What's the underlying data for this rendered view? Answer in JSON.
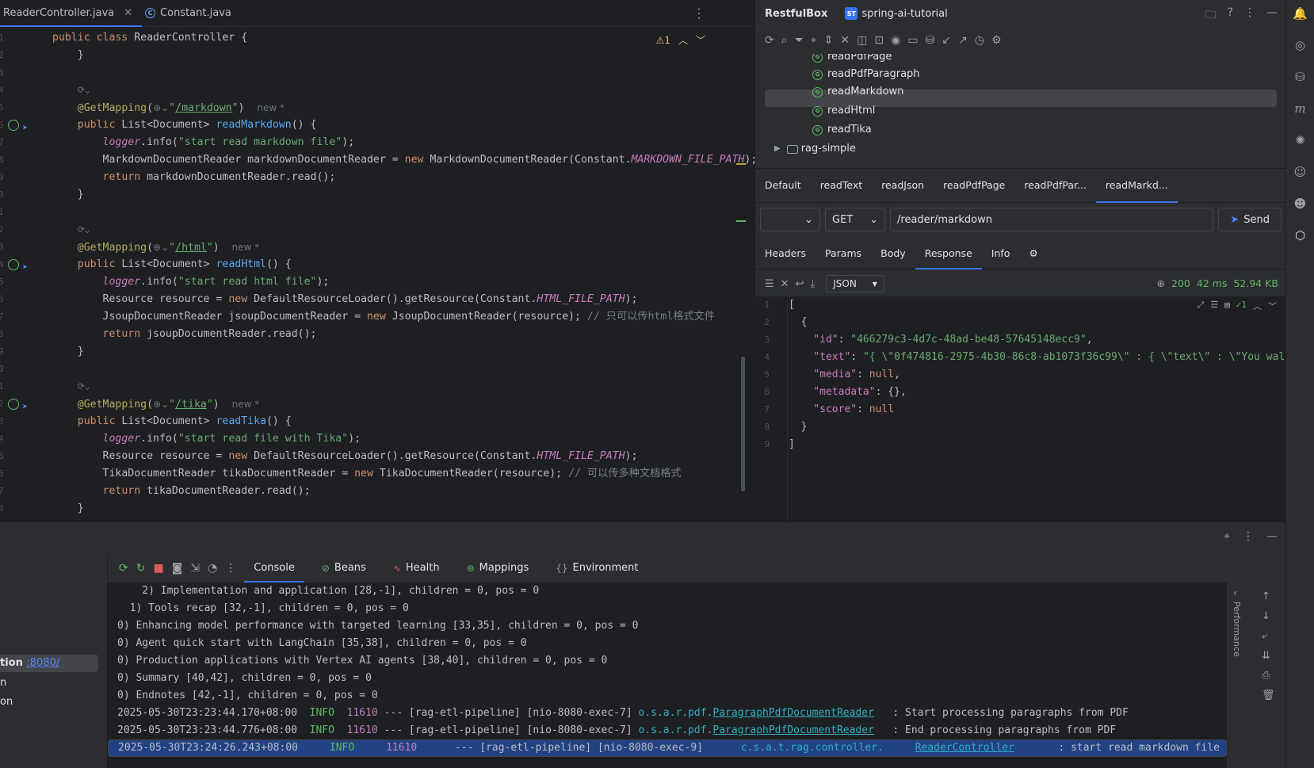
{
  "editor": {
    "tabs": [
      {
        "label": "ReaderController.java",
        "active": true
      },
      {
        "label": "Constant.java",
        "active": false
      }
    ],
    "warning_count": "1",
    "lines": [
      {
        "n": "1",
        "html": "<span class=\"kw\">public class</span> ReaderController {",
        "indent": 0
      },
      {
        "n": "2",
        "html": "    }",
        "indent": 0
      },
      {
        "n": "3",
        "html": "",
        "indent": 0
      },
      {
        "n": "4",
        "html": "    <span class=\"fold\">⟳⌄</span>",
        "indent": 0
      },
      {
        "n": "5",
        "html": "    <span class=\"ann\">@GetMapping</span>(<span class=\"hint\">⊕⌄</span><span class=\"str\">\"<u>/markdown</u>\"</span>)  <span class=\"hint\">new *</span>",
        "indent": 0
      },
      {
        "n": "6",
        "html": "    <span class=\"kw\">public</span> List&lt;Document&gt; <span class=\"fn\">readMarkdown</span>() {",
        "indent": 0
      },
      {
        "n": "7",
        "html": "        <span class=\"cst\">logger</span>.info(<span class=\"str\">\"start read markdown file\"</span>);",
        "indent": 0
      },
      {
        "n": "8",
        "html": "        MarkdownDocumentReader markdownDocumentReader = <span class=\"kw\">new</span> MarkdownDocumentReader(Constant.<span class=\"cst\">MARKDOWN_FILE_PATH</span>);",
        "indent": 0
      },
      {
        "n": "9",
        "html": "        <span class=\"kw\">return</span> markdownDocumentReader.read();",
        "indent": 0
      },
      {
        "n": "0",
        "html": "    }",
        "indent": 0
      },
      {
        "n": "1",
        "html": "",
        "indent": 0
      },
      {
        "n": "2",
        "html": "    <span class=\"fold\">⟳⌄</span>",
        "indent": 0
      },
      {
        "n": "3",
        "html": "    <span class=\"ann\">@GetMapping</span>(<span class=\"hint\">⊕⌄</span><span class=\"str\">\"<u>/html</u>\"</span>)  <span class=\"hint\">new *</span>",
        "indent": 0
      },
      {
        "n": "4",
        "html": "    <span class=\"kw\">public</span> List&lt;Document&gt; <span class=\"fn\">readHtml</span>() {",
        "indent": 0
      },
      {
        "n": "5",
        "html": "        <span class=\"cst\">logger</span>.info(<span class=\"str\">\"start read html file\"</span>);",
        "indent": 0
      },
      {
        "n": "6",
        "html": "        Resource resource = <span class=\"kw\">new</span> DefaultResourceLoader().getResource(Constant.<span class=\"cst\">HTML_FILE_PATH</span>);",
        "indent": 0
      },
      {
        "n": "7",
        "html": "        JsoupDocumentReader jsoupDocumentReader = <span class=\"kw\">new</span> JsoupDocumentReader(resource); <span class=\"cmt\">// 只可以传html格式文件</span>",
        "indent": 0
      },
      {
        "n": "8",
        "html": "        <span class=\"kw\">return</span> jsoupDocumentReader.read();",
        "indent": 0
      },
      {
        "n": "9",
        "html": "    }",
        "indent": 0
      },
      {
        "n": "0",
        "html": "",
        "indent": 0
      },
      {
        "n": "1",
        "html": "    <span class=\"fold\">⟳⌄</span>",
        "indent": 0
      },
      {
        "n": "2",
        "html": "    <span class=\"ann\">@GetMapping</span>(<span class=\"hint\">⊕⌄</span><span class=\"str\">\"<u>/tika</u>\"</span>)  <span class=\"hint\">new *</span>",
        "indent": 0
      },
      {
        "n": "3",
        "html": "    <span class=\"kw\">public</span> List&lt;Document&gt; <span class=\"fn\">readTika</span>() {",
        "indent": 0
      },
      {
        "n": "4",
        "html": "        <span class=\"cst\">logger</span>.info(<span class=\"str\">\"start read file with Tika\"</span>);",
        "indent": 0
      },
      {
        "n": "5",
        "html": "        Resource resource = <span class=\"kw\">new</span> DefaultResourceLoader().getResource(Constant.<span class=\"cst\">HTML_FILE_PATH</span>);",
        "indent": 0
      },
      {
        "n": "6",
        "html": "        TikaDocumentReader tikaDocumentReader = <span class=\"kw\">new</span> TikaDocumentReader(resource); <span class=\"cmt\">// 可以传多种文档格式</span>",
        "indent": 0
      },
      {
        "n": "7",
        "html": "        <span class=\"kw\">return</span> tikaDocumentReader.read();",
        "indent": 0
      },
      {
        "n": "8",
        "html": "    }",
        "indent": 0
      },
      {
        "n": "9",
        "html": "}",
        "indent": 0
      }
    ]
  },
  "restful": {
    "title": "RestfulBox",
    "project_badge": "ST",
    "project": "spring-ai-tutorial",
    "tree": [
      {
        "label": "readPdfPage",
        "type": "endpoint"
      },
      {
        "label": "readPdfParagraph",
        "type": "endpoint"
      },
      {
        "label": "readMarkdown",
        "type": "endpoint",
        "selected": true
      },
      {
        "label": "readHtml",
        "type": "endpoint"
      },
      {
        "label": "readTika",
        "type": "endpoint"
      },
      {
        "label": "rag-simple",
        "type": "folder"
      }
    ],
    "request_tabs": [
      "Default",
      "readText",
      "readJson",
      "readPdfPage",
      "readPdfPar...",
      "readMarkd..."
    ],
    "env_value": "",
    "method": "GET",
    "url": "/reader/markdown",
    "send_label": "Send",
    "response_tabs": [
      "Headers",
      "Params",
      "Body",
      "Response",
      "Info"
    ],
    "format": "JSON",
    "status": "200",
    "time": "42 ms",
    "size": "52.94 KB",
    "check_count": "1",
    "json_lines": [
      {
        "n": "1",
        "html": "["
      },
      {
        "n": "2",
        "html": "  {"
      },
      {
        "n": "3",
        "html": "    <span class=\"jkey\">\"id\"</span>: <span class=\"jstr\">\"466279c3-4d7c-48ad-be48-57645148ecc9\"</span>,"
      },
      {
        "n": "4",
        "html": "    <span class=\"jkey\">\"text\"</span>: <span class=\"jstr\">\"{ \\\"0f474816-2975-4b30-86c8-ab1073f36c99\\\" : { \\\"text\\\" : \\\"You wal</span>"
      },
      {
        "n": "5",
        "html": "    <span class=\"jkey\">\"media\"</span>: <span class=\"jnull\">null</span>,"
      },
      {
        "n": "6",
        "html": "    <span class=\"jkey\">\"metadata\"</span>: {},"
      },
      {
        "n": "7",
        "html": "    <span class=\"jkey\">\"score\"</span>: <span class=\"jnull\">null</span>"
      },
      {
        "n": "8",
        "html": "  }"
      },
      {
        "n": "9",
        "html": "]"
      }
    ]
  },
  "services": {
    "selected_prefix": "tion ",
    "selected_link": ":8080/",
    "items": [
      "n",
      "on"
    ]
  },
  "console": {
    "tabs": [
      {
        "label": "Console",
        "icon": "",
        "active": true
      },
      {
        "label": "Beans",
        "icon": "beans-icon"
      },
      {
        "label": "Health",
        "icon": "health-icon"
      },
      {
        "label": "Mappings",
        "icon": "mappings-icon"
      },
      {
        "label": "Environment",
        "icon": "environment-icon"
      }
    ],
    "plain_lines": [
      "    2) Implementation and application [28,-1], children = 0, pos = 0",
      "  1) Tools recap [32,-1], children = 0, pos = 0",
      "0) Enhancing model performance with targeted learning [33,35], children = 0, pos = 0",
      "0) Agent quick start with LangChain [35,38], children = 0, pos = 0",
      "0) Production applications with Vertex AI agents [38,40], children = 0, pos = 0",
      "0) Summary [40,42], children = 0, pos = 0",
      "0) Endnotes [42,-1], children = 0, pos = 0"
    ],
    "log_lines": [
      {
        "ts": "2025-05-30T23:23:44.170+08:00",
        "level": "INFO",
        "pid": "11610",
        "thread": " --- [rag-etl-pipeline] [nio-8080-exec-7] ",
        "pkg": "o.s.a.r.pdf.",
        "cls": "ParagraphPdfDocumentReader",
        "msg": "   : Start processing paragraphs from PDF",
        "selected": false
      },
      {
        "ts": "2025-05-30T23:23:44.776+08:00",
        "level": "INFO",
        "pid": "11610",
        "thread": " --- [rag-etl-pipeline] [nio-8080-exec-7] ",
        "pkg": "o.s.a.r.pdf.",
        "cls": "ParagraphPdfDocumentReader",
        "msg": "   : End processing paragraphs from PDF",
        "selected": false
      },
      {
        "ts": "2025-05-30T23:24:26.243+08:00",
        "level": "INFO",
        "pid": "11610",
        "thread": " --- [rag-etl-pipeline] [nio-8080-exec-9] ",
        "pkg": "c.s.a.t.rag.controller.",
        "cls": "ReaderController",
        "msg": "  : start read markdown file",
        "selected": true
      }
    ],
    "side_label": "Performance"
  }
}
